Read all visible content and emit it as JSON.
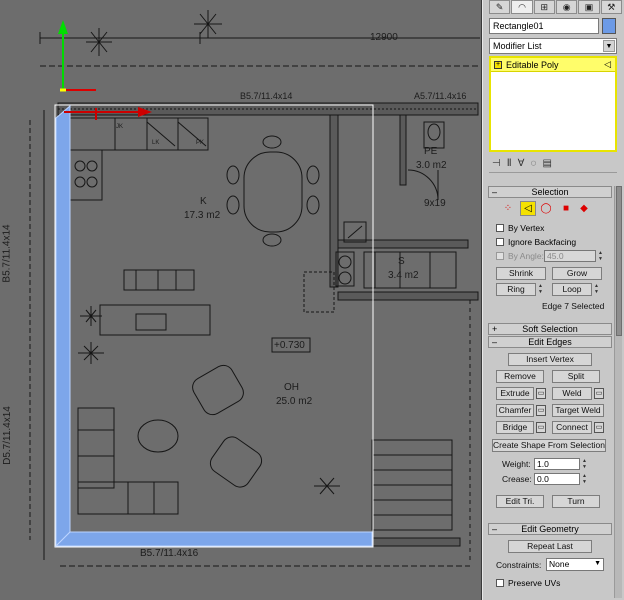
{
  "viewport": {
    "annotations": {
      "dim_top": "12900",
      "wall_label_top": "B5.7/11.4x14",
      "wall_label_top_right": "A5.7/11.4x16",
      "room_k_name": "K",
      "room_k_area": "17.3 m2",
      "room_pe_name": "PE",
      "room_pe_area": "3.0 m2",
      "room_s_name": "S",
      "room_s_area": "3.4 m2",
      "room_oh_name": "OH",
      "room_oh_area": "25.0 m2",
      "door_label": "9x19",
      "level_box": "+0.730",
      "left_label_1": "B5.7/11.4x14",
      "left_label_2": "D5.7/11.4x14",
      "bottom_label": "B5.7/11.4x16",
      "cab_jk": "JK",
      "cab_pk": "PK",
      "cab_lk": "LK"
    }
  },
  "command_panel": {
    "tabs": [
      "create-icon",
      "modify-icon",
      "hierarchy-icon",
      "motion-icon",
      "display-icon",
      "utilities-icon"
    ],
    "object_name": "Rectangle01",
    "object_color": "#6c9ae6",
    "modifier_list_label": "Modifier List",
    "stack": [
      {
        "label": "Editable Poly",
        "icon": "plus-icon",
        "sub_icon": "edge-icon"
      }
    ],
    "stack_tools": [
      "pin-stack-icon",
      "show-end-result-icon",
      "make-unique-icon",
      "remove-modifier-icon",
      "configure-sets-icon"
    ]
  },
  "selection": {
    "header": "Selection",
    "subobject_icons": [
      "vertex-icon",
      "edge-icon",
      "border-icon",
      "polygon-icon",
      "element-icon"
    ],
    "by_vertex": "By Vertex",
    "ignore_backfacing": "Ignore Backfacing",
    "by_angle": "By Angle:",
    "angle_value": "45.0",
    "shrink": "Shrink",
    "grow": "Grow",
    "ring": "Ring",
    "loop": "Loop",
    "status": "Edge 7 Selected"
  },
  "soft_selection": {
    "header": "Soft Selection"
  },
  "edit_edges": {
    "header": "Edit Edges",
    "insert_vertex": "Insert Vertex",
    "remove": "Remove",
    "split": "Split",
    "extrude": "Extrude",
    "weld": "Weld",
    "chamfer": "Chamfer",
    "target_weld": "Target Weld",
    "bridge": "Bridge",
    "connect": "Connect",
    "create_shape": "Create Shape From Selection",
    "weight_label": "Weight:",
    "weight_value": "1.0",
    "crease_label": "Crease:",
    "crease_value": "0.0",
    "edit_tri": "Edit Tri.",
    "turn": "Turn"
  },
  "edit_geometry": {
    "header": "Edit Geometry",
    "repeat_last": "Repeat Last",
    "constraints_label": "Constraints:",
    "constraints_value": "None",
    "preserve_uvs": "Preserve UVs"
  }
}
